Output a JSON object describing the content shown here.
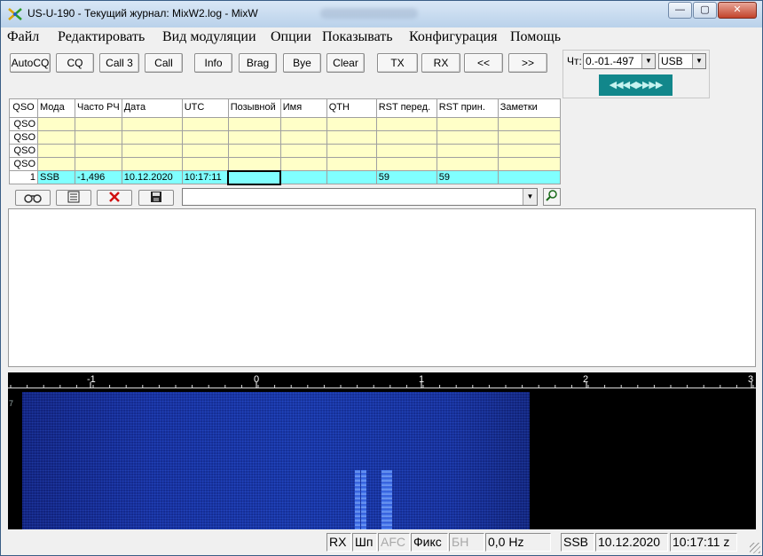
{
  "window": {
    "title": "US-U-190 - Текущий журнал: MixW2.log - MixW",
    "minimize_label": "—",
    "maximize_label": "▢",
    "close_label": "✕"
  },
  "menu": [
    "Файл",
    "Редактировать",
    "Вид модуляции",
    "Опции",
    "Показывать",
    "Конфигурация",
    "Помощь"
  ],
  "toolbar": {
    "buttons": [
      "AutoCQ",
      "CQ",
      "Call 3",
      "Call",
      "Info",
      "Brag",
      "Bye",
      "Clear",
      "TX",
      "RX",
      "<<",
      ">>"
    ]
  },
  "right_panel": {
    "label": "Чт:",
    "channel_value": "0.-01.-497",
    "mode_value": "USB",
    "arrows": "◀◀◀◀▶▶▶▶"
  },
  "qso_table": {
    "headers": [
      "QSO",
      "Мода",
      "Часто РЧ",
      "Дата",
      "UTC",
      "Позывной",
      "Имя",
      "QTH",
      "RST перед.",
      "RST прин.",
      "Заметки"
    ],
    "empty_row_label": "QSO",
    "active_row": [
      "1",
      "SSB",
      "-1,496",
      "10.12.2020",
      "10:17:11",
      "",
      "",
      "",
      "59",
      "59",
      ""
    ]
  },
  "log_toolbar": {
    "buttons": [
      "binoculars-icon",
      "notepad-icon",
      "delete-icon",
      "save-icon"
    ],
    "combo_value": ""
  },
  "waterfall": {
    "scale_labels": [
      "-1",
      "0",
      "1",
      "2",
      "3"
    ],
    "left_label": "7"
  },
  "statusbar": {
    "rx": "RX",
    "squelch": "Шп",
    "afc": "AFC",
    "fixed": "Фикс",
    "bn": "БН",
    "offset": "0,0 Hz",
    "mode": "SSB",
    "date": "10.12.2020",
    "time": "10:17:11 z"
  },
  "colors": {
    "table_empty_row": "#ffffc8",
    "table_active_row": "#80ffff",
    "arrows_bar": "#12878b",
    "waterfall_bg": "#000000",
    "waterfall_noise": "#1843c4"
  }
}
